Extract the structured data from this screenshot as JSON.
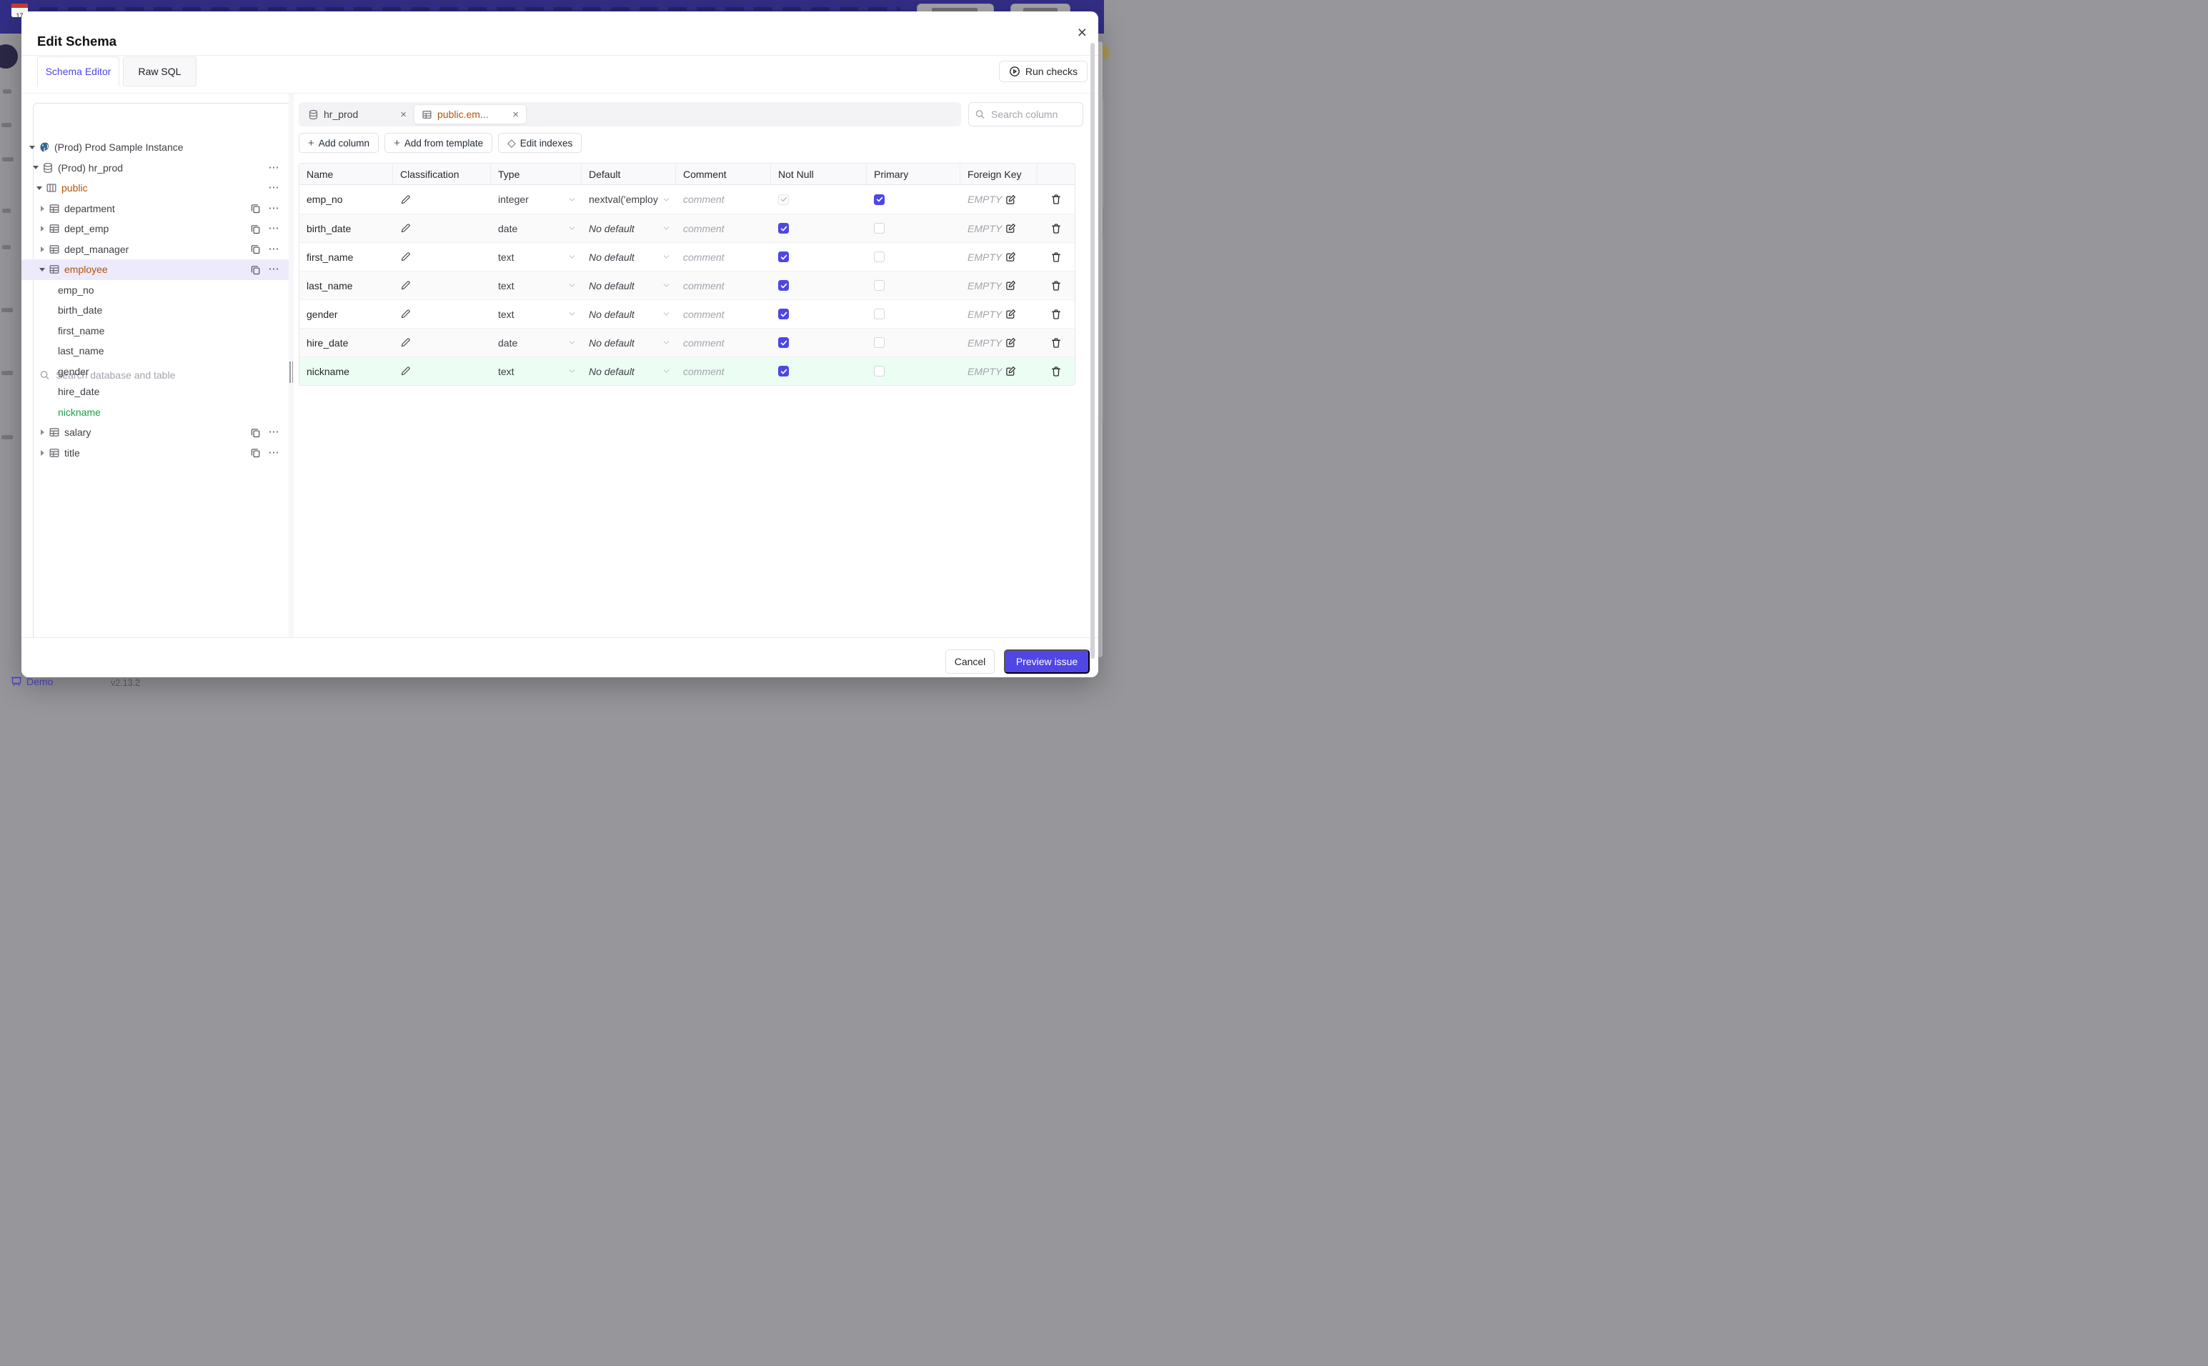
{
  "glyphs": {
    "close": "×",
    "plus": "+",
    "diamond": "◇",
    "dots": "⋯"
  },
  "chrome": {
    "logo_day": "17",
    "demo_label": "Demo",
    "version": "v2.13.2"
  },
  "modal": {
    "title": "Edit Schema",
    "tabs": [
      {
        "label": "Schema Editor",
        "active": true
      },
      {
        "label": "Raw SQL",
        "active": false
      }
    ],
    "run_checks_label": "Run checks"
  },
  "sidebar": {
    "search_placeholder": "Search database and table",
    "tree": [
      {
        "label": "(Prod) Prod Sample Instance",
        "depth": 0,
        "icon": "postgres",
        "caret": "down"
      },
      {
        "label": "(Prod) hr_prod",
        "depth": 1,
        "icon": "database",
        "caret": "down",
        "menu": true
      },
      {
        "label": "public",
        "depth": 2,
        "icon": "schema",
        "caret": "down",
        "menu": true,
        "amber": true
      },
      {
        "label": "department",
        "depth": 3,
        "icon": "table",
        "caret": "right",
        "copy": true,
        "menu": true
      },
      {
        "label": "dept_emp",
        "depth": 3,
        "icon": "table",
        "caret": "right",
        "copy": true,
        "menu": true
      },
      {
        "label": "dept_manager",
        "depth": 3,
        "icon": "table",
        "caret": "right",
        "copy": true,
        "menu": true
      },
      {
        "label": "employee",
        "depth": 3,
        "icon": "table",
        "caret": "down",
        "copy": true,
        "menu": true,
        "amber": true,
        "selected": true
      },
      {
        "label": "emp_no",
        "depth": 4,
        "column": true
      },
      {
        "label": "birth_date",
        "depth": 4,
        "column": true
      },
      {
        "label": "first_name",
        "depth": 4,
        "column": true
      },
      {
        "label": "last_name",
        "depth": 4,
        "column": true
      },
      {
        "label": "gender",
        "depth": 4,
        "column": true
      },
      {
        "label": "hire_date",
        "depth": 4,
        "column": true
      },
      {
        "label": "nickname",
        "depth": 4,
        "column": true,
        "green": true
      },
      {
        "label": "salary",
        "depth": 3,
        "icon": "table",
        "caret": "right",
        "copy": true,
        "menu": true
      },
      {
        "label": "title",
        "depth": 3,
        "icon": "table",
        "caret": "right",
        "copy": true,
        "menu": true
      }
    ]
  },
  "editor": {
    "chips": [
      {
        "label": "hr_prod",
        "icon": "database",
        "active": false
      },
      {
        "label": "public.em...",
        "icon": "table",
        "active": true
      }
    ],
    "search_placeholder": "Search column",
    "actions": [
      {
        "label": "Add column",
        "icon": "plus"
      },
      {
        "label": "Add from template",
        "icon": "plus"
      },
      {
        "label": "Edit indexes",
        "icon": "diamond"
      }
    ]
  },
  "table": {
    "headers": [
      "Name",
      "Classification",
      "Type",
      "Default",
      "Comment",
      "Not Null",
      "Primary",
      "Foreign Key",
      ""
    ],
    "comment_placeholder": "comment",
    "fk_empty": "EMPTY",
    "rows": [
      {
        "name": "emp_no",
        "type": "integer",
        "default": "nextval('employ",
        "default_muted": false,
        "not_null": true,
        "not_null_disabled": true,
        "primary": true,
        "is_new": false
      },
      {
        "name": "birth_date",
        "type": "date",
        "default": "No default",
        "default_muted": true,
        "not_null": true,
        "not_null_disabled": false,
        "primary": false,
        "is_new": false
      },
      {
        "name": "first_name",
        "type": "text",
        "default": "No default",
        "default_muted": true,
        "not_null": true,
        "not_null_disabled": false,
        "primary": false,
        "is_new": false
      },
      {
        "name": "last_name",
        "type": "text",
        "default": "No default",
        "default_muted": true,
        "not_null": true,
        "not_null_disabled": false,
        "primary": false,
        "is_new": false
      },
      {
        "name": "gender",
        "type": "text",
        "default": "No default",
        "default_muted": true,
        "not_null": true,
        "not_null_disabled": false,
        "primary": false,
        "is_new": false
      },
      {
        "name": "hire_date",
        "type": "date",
        "default": "No default",
        "default_muted": true,
        "not_null": true,
        "not_null_disabled": false,
        "primary": false,
        "is_new": false
      },
      {
        "name": "nickname",
        "type": "text",
        "default": "No default",
        "default_muted": true,
        "not_null": true,
        "not_null_disabled": false,
        "primary": false,
        "is_new": true
      }
    ]
  },
  "footer": {
    "cancel_label": "Cancel",
    "submit_label": "Preview issue"
  },
  "colors": {
    "accent": "#4f46e5",
    "amber": "#b45309",
    "green": "#16a34a",
    "green_row_bg": "#ecfdf3",
    "navy": "#322e85"
  }
}
